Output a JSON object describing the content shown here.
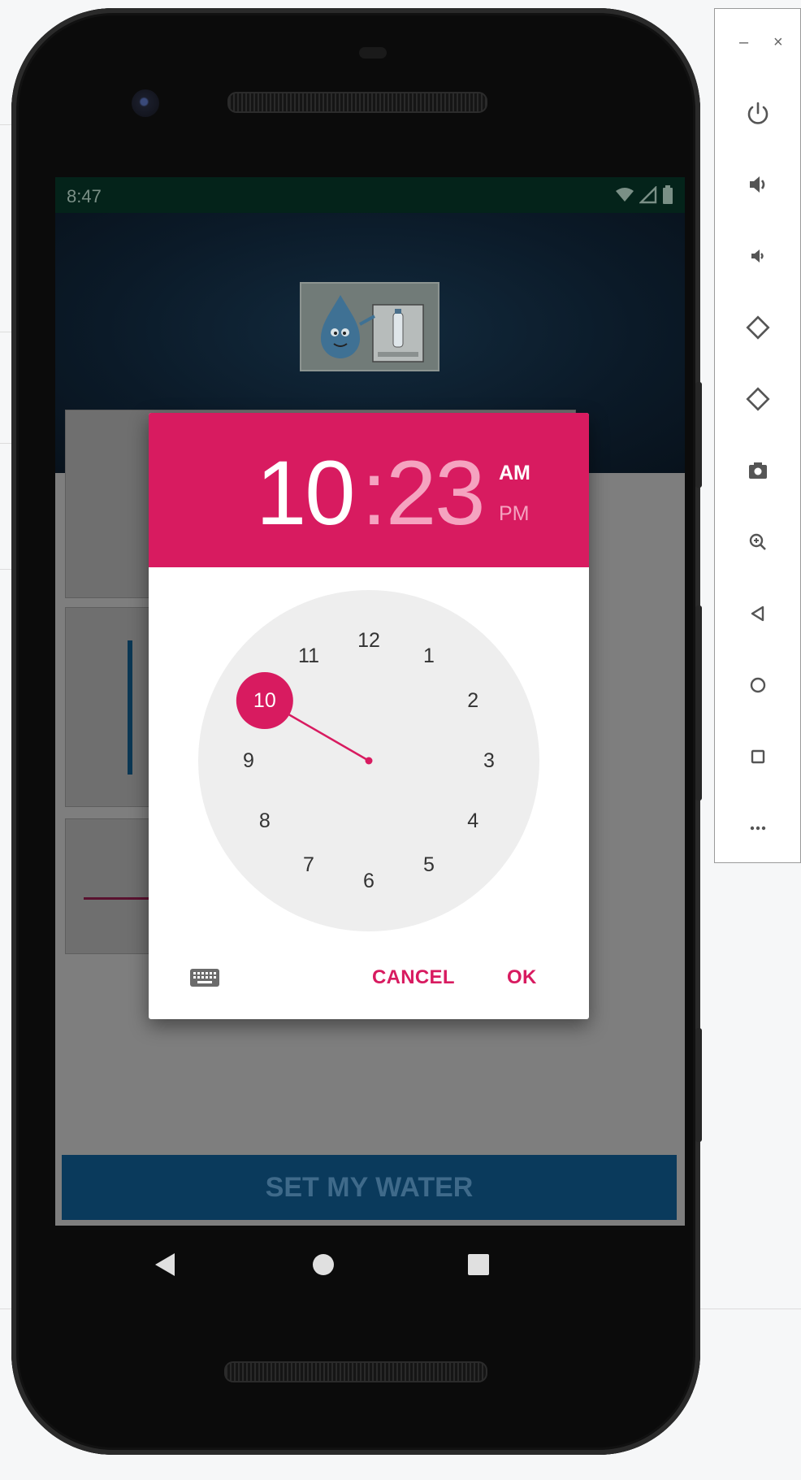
{
  "status_bar": {
    "time": "8:47"
  },
  "timepicker": {
    "hour": "10",
    "colon": ":",
    "minute": "23",
    "am": "AM",
    "pm": "PM",
    "selected_period": "AM",
    "selected_hour": 10,
    "hours": [
      "12",
      "1",
      "2",
      "3",
      "4",
      "5",
      "6",
      "7",
      "8",
      "9",
      "10",
      "11"
    ],
    "cancel_label": "CANCEL",
    "ok_label": "OK"
  },
  "main": {
    "set_water_label": "SET MY WATER",
    "seekbar_progress_fraction": 0.26
  },
  "colors": {
    "accent": "#d81b60",
    "accent_light": "#f5a3c0",
    "clock_face": "#eeeeee",
    "primary_dark": "#0a3a5c"
  },
  "icons": {
    "side_panel": [
      "power-icon",
      "volume-up-icon",
      "volume-down-icon",
      "rotate-left-icon",
      "rotate-right-icon",
      "camera-icon",
      "zoom-icon",
      "back-icon",
      "home-icon",
      "overview-icon",
      "more-icon"
    ],
    "nav": [
      "back-icon",
      "home-icon",
      "recents-icon"
    ],
    "dialog": [
      "keyboard-icon"
    ]
  }
}
